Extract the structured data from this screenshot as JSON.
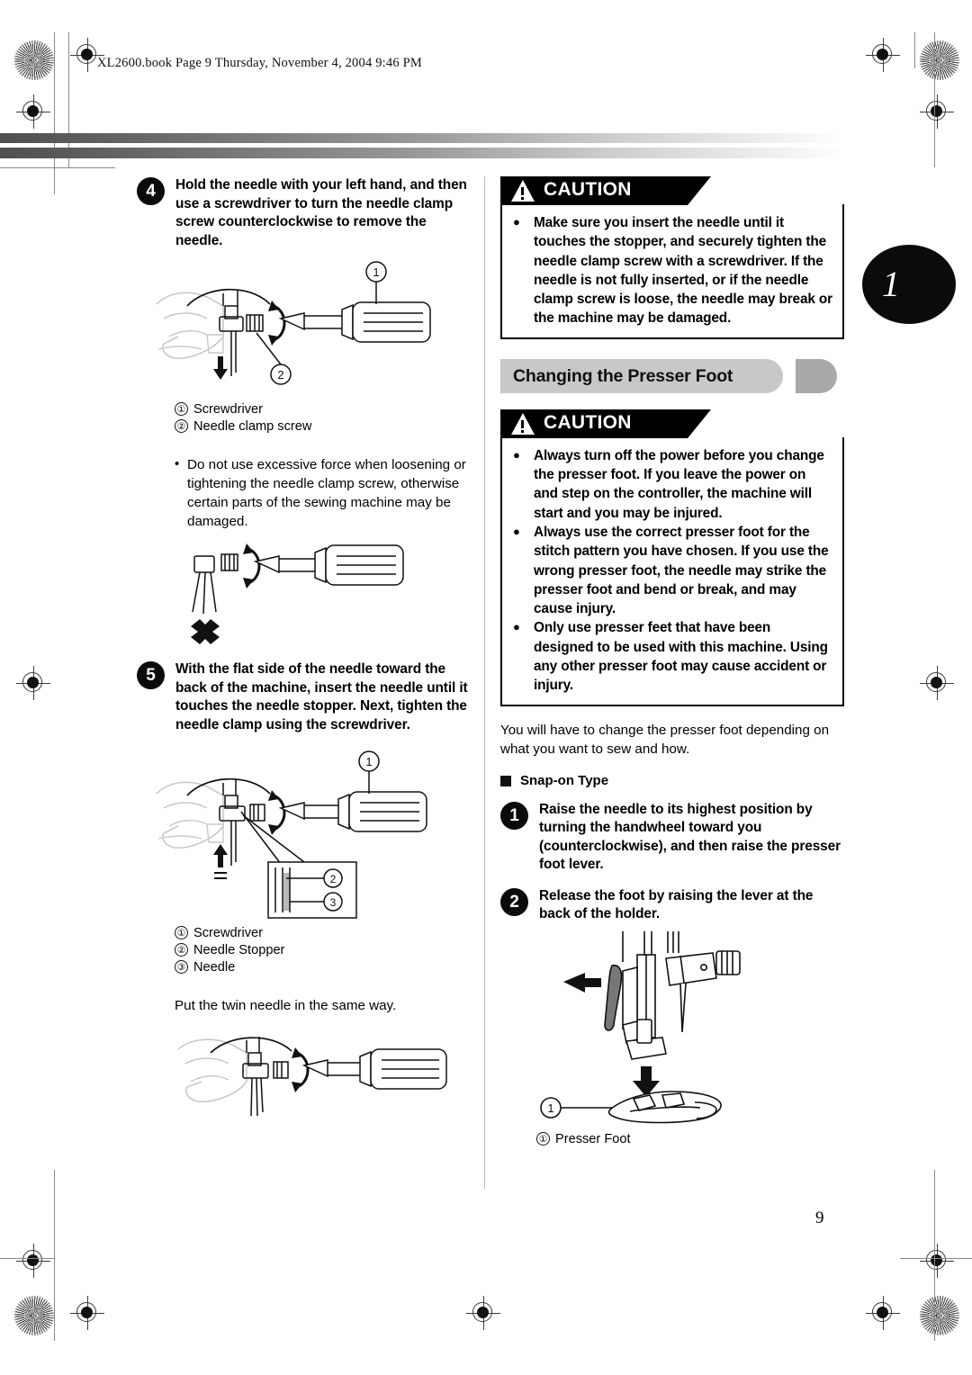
{
  "document": {
    "file_header": "XL2600.book  Page 9  Thursday, November 4, 2004  9:46 PM",
    "page_number": "9",
    "chapter_tab": "1"
  },
  "left_column": {
    "step4": {
      "number": "4",
      "text": "Hold the needle with your left hand, and then use a screwdriver to turn the needle clamp screw counterclockwise to remove the needle."
    },
    "figure1": {
      "callouts": [
        "1",
        "2"
      ],
      "captions": [
        {
          "num": "①",
          "label": "Screwdriver"
        },
        {
          "num": "②",
          "label": "Needle clamp screw"
        }
      ]
    },
    "note_bullet": "Do not use excessive force when loosening or tightening the needle clamp screw, otherwise certain parts of the sewing machine may be damaged.",
    "step5": {
      "number": "5",
      "text": "With the flat side of the needle toward the back of the machine, insert the needle until it touches the needle stopper. Next, tighten the needle clamp using the screwdriver."
    },
    "figure2": {
      "callouts": [
        "1",
        "2",
        "3"
      ],
      "captions": [
        {
          "num": "①",
          "label": "Screwdriver"
        },
        {
          "num": "②",
          "label": "Needle Stopper"
        },
        {
          "num": "③",
          "label": "Needle"
        }
      ]
    },
    "twin_needle_note": "Put the twin needle in the same way."
  },
  "right_column": {
    "caution1": {
      "title": "CAUTION",
      "items": [
        "Make sure you insert the needle until it touches the stopper, and securely tighten the needle clamp screw with a screwdriver. If the needle is not fully inserted, or if the needle clamp screw is loose, the needle may break or the machine may be damaged."
      ]
    },
    "section_title": "Changing the Presser Foot",
    "caution2": {
      "title": "CAUTION",
      "items": [
        "Always turn off the power before you change the presser foot. If you leave the power on and step on the controller, the machine will start and you may be injured.",
        "Always use the correct presser foot for the stitch pattern you have chosen. If you use the wrong presser foot, the needle may strike the presser foot and bend or break, and may cause injury.",
        "Only use presser feet that have been designed to be used with this machine. Using any other presser foot may cause accident or injury."
      ]
    },
    "intro_paragraph": "You will have to change the presser foot depending on what you want to sew and how.",
    "sub_heading": "Snap-on Type",
    "step1": {
      "number": "1",
      "text": "Raise the needle to its highest position by turning the handwheel toward you (counterclockwise), and then raise the presser foot lever."
    },
    "step2": {
      "number": "2",
      "text": "Release the foot by raising the lever at the back of the holder."
    },
    "figure3": {
      "callouts": [
        "1"
      ],
      "captions": [
        {
          "num": "①",
          "label": "Presser Foot"
        }
      ]
    }
  },
  "colors": {
    "ink": "#000000",
    "banner_gray": "#c8c8c8",
    "pill_gray": "#a9a9a9",
    "rule_gray": "#b8b8b8"
  }
}
